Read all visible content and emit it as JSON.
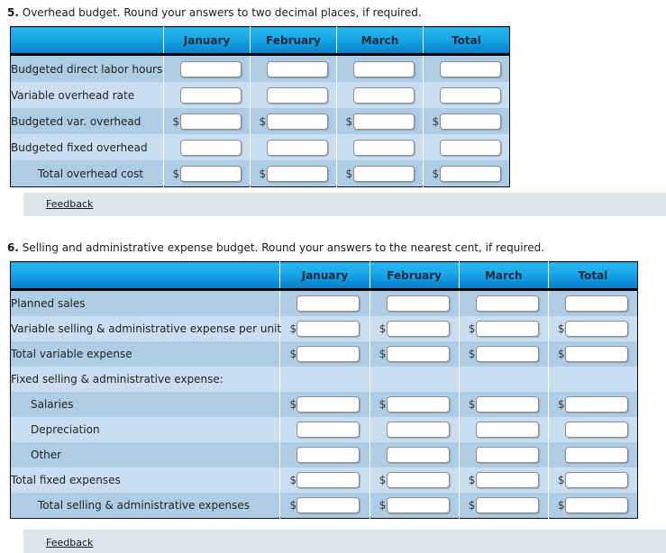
{
  "questions": [
    {
      "number": "5.",
      "prompt": "Overhead budget. Round your answers to two decimal places, if required.",
      "table": {
        "headers": [
          "",
          "January",
          "February",
          "March",
          "Total"
        ],
        "rows": [
          {
            "label": "Budgeted direct labor hours",
            "dollar": false
          },
          {
            "label": "Variable overhead rate",
            "dollar": false
          },
          {
            "label": "Budgeted var. overhead",
            "dollar": true
          },
          {
            "label": "Budgeted fixed overhead",
            "dollar": false
          },
          {
            "label": "Total overhead cost",
            "dollar": true
          }
        ]
      },
      "feedback_label": "Feedback"
    },
    {
      "number": "6.",
      "prompt": "Selling and administrative expense budget. Round your answers to the nearest cent, if required.",
      "table": {
        "headers": [
          "",
          "January",
          "February",
          "March",
          "Total"
        ],
        "rows": [
          {
            "label": "Planned sales",
            "dollar": false
          },
          {
            "label": "Variable selling & administrative expense per unit",
            "dollar": true
          },
          {
            "label": "Total variable expense",
            "dollar": true
          },
          {
            "label": "Fixed selling & administrative expense:",
            "dollar": false
          },
          {
            "label": "Salaries",
            "dollar": true
          },
          {
            "label": "Depreciation",
            "dollar": false
          },
          {
            "label": "Other",
            "dollar": false
          },
          {
            "label": "Total fixed expenses",
            "dollar": true
          },
          {
            "label": "Total selling & administrative expenses",
            "dollar": true
          }
        ]
      },
      "feedback_label": "Feedback"
    }
  ],
  "currency_symbol": "$",
  "colors": {
    "header_gradient_top": "#29b7ef",
    "header_gradient_bottom": "#0b7cc4",
    "header_text": "#16293d",
    "row_dark": "#aecde5",
    "row_light": "#c9dff1",
    "table_border": "#0a0a0a",
    "feedback_background": "#dde5ea",
    "input_background": "#ffffff",
    "input_border": "#8c8c8c",
    "page_background": "#ffffff"
  }
}
